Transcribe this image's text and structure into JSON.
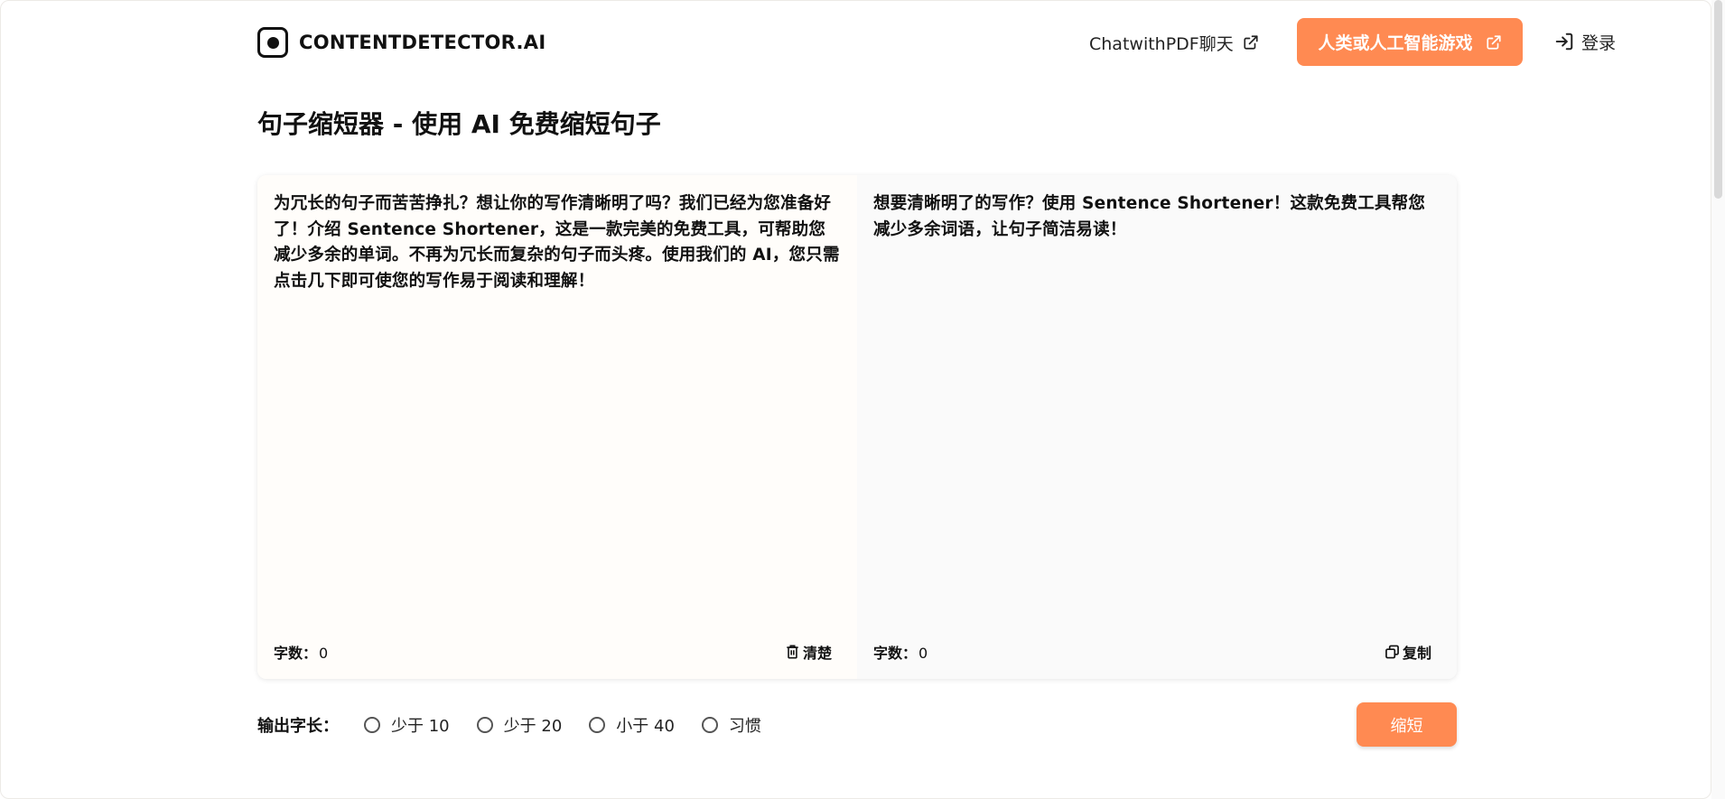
{
  "header": {
    "logo_text": "CONTENTDETECTOR.AI",
    "chat_link": "ChatwithPDF聊天",
    "cta_label": "人类或人工智能游戏",
    "login_label": "登录"
  },
  "page": {
    "title": "句子缩短器 - 使用 AI 免费缩短句子"
  },
  "editor": {
    "input_text": "为冗长的句子而苦苦挣扎？想让你的写作清晰明了吗？我们已经为您准备好了！介绍 Sentence Shortener，这是一款完美的免费工具，可帮助您减少多余的单词。不再为冗长而复杂的句子而头疼。使用我们的 AI，您只需点击几下即可使您的写作易于阅读和理解！",
    "output_text": "想要清晰明了的写作？使用 Sentence Shortener！这款免费工具帮您减少多余词语，让句子简洁易读！",
    "word_count_label": "字数：",
    "input_word_count": "0",
    "output_word_count": "0",
    "clear_label": "清楚",
    "copy_label": "复制"
  },
  "options": {
    "label": "输出字长：",
    "choices": [
      {
        "label": "少于 10",
        "selected": false
      },
      {
        "label": "少于 20",
        "selected": false
      },
      {
        "label": "小于 40",
        "selected": false
      },
      {
        "label": "习惯",
        "selected": false
      }
    ]
  },
  "submit_label": "缩短",
  "colors": {
    "accent": "#ff8a52",
    "input_bg": "#fffdfa",
    "output_bg": "#fafafa"
  }
}
